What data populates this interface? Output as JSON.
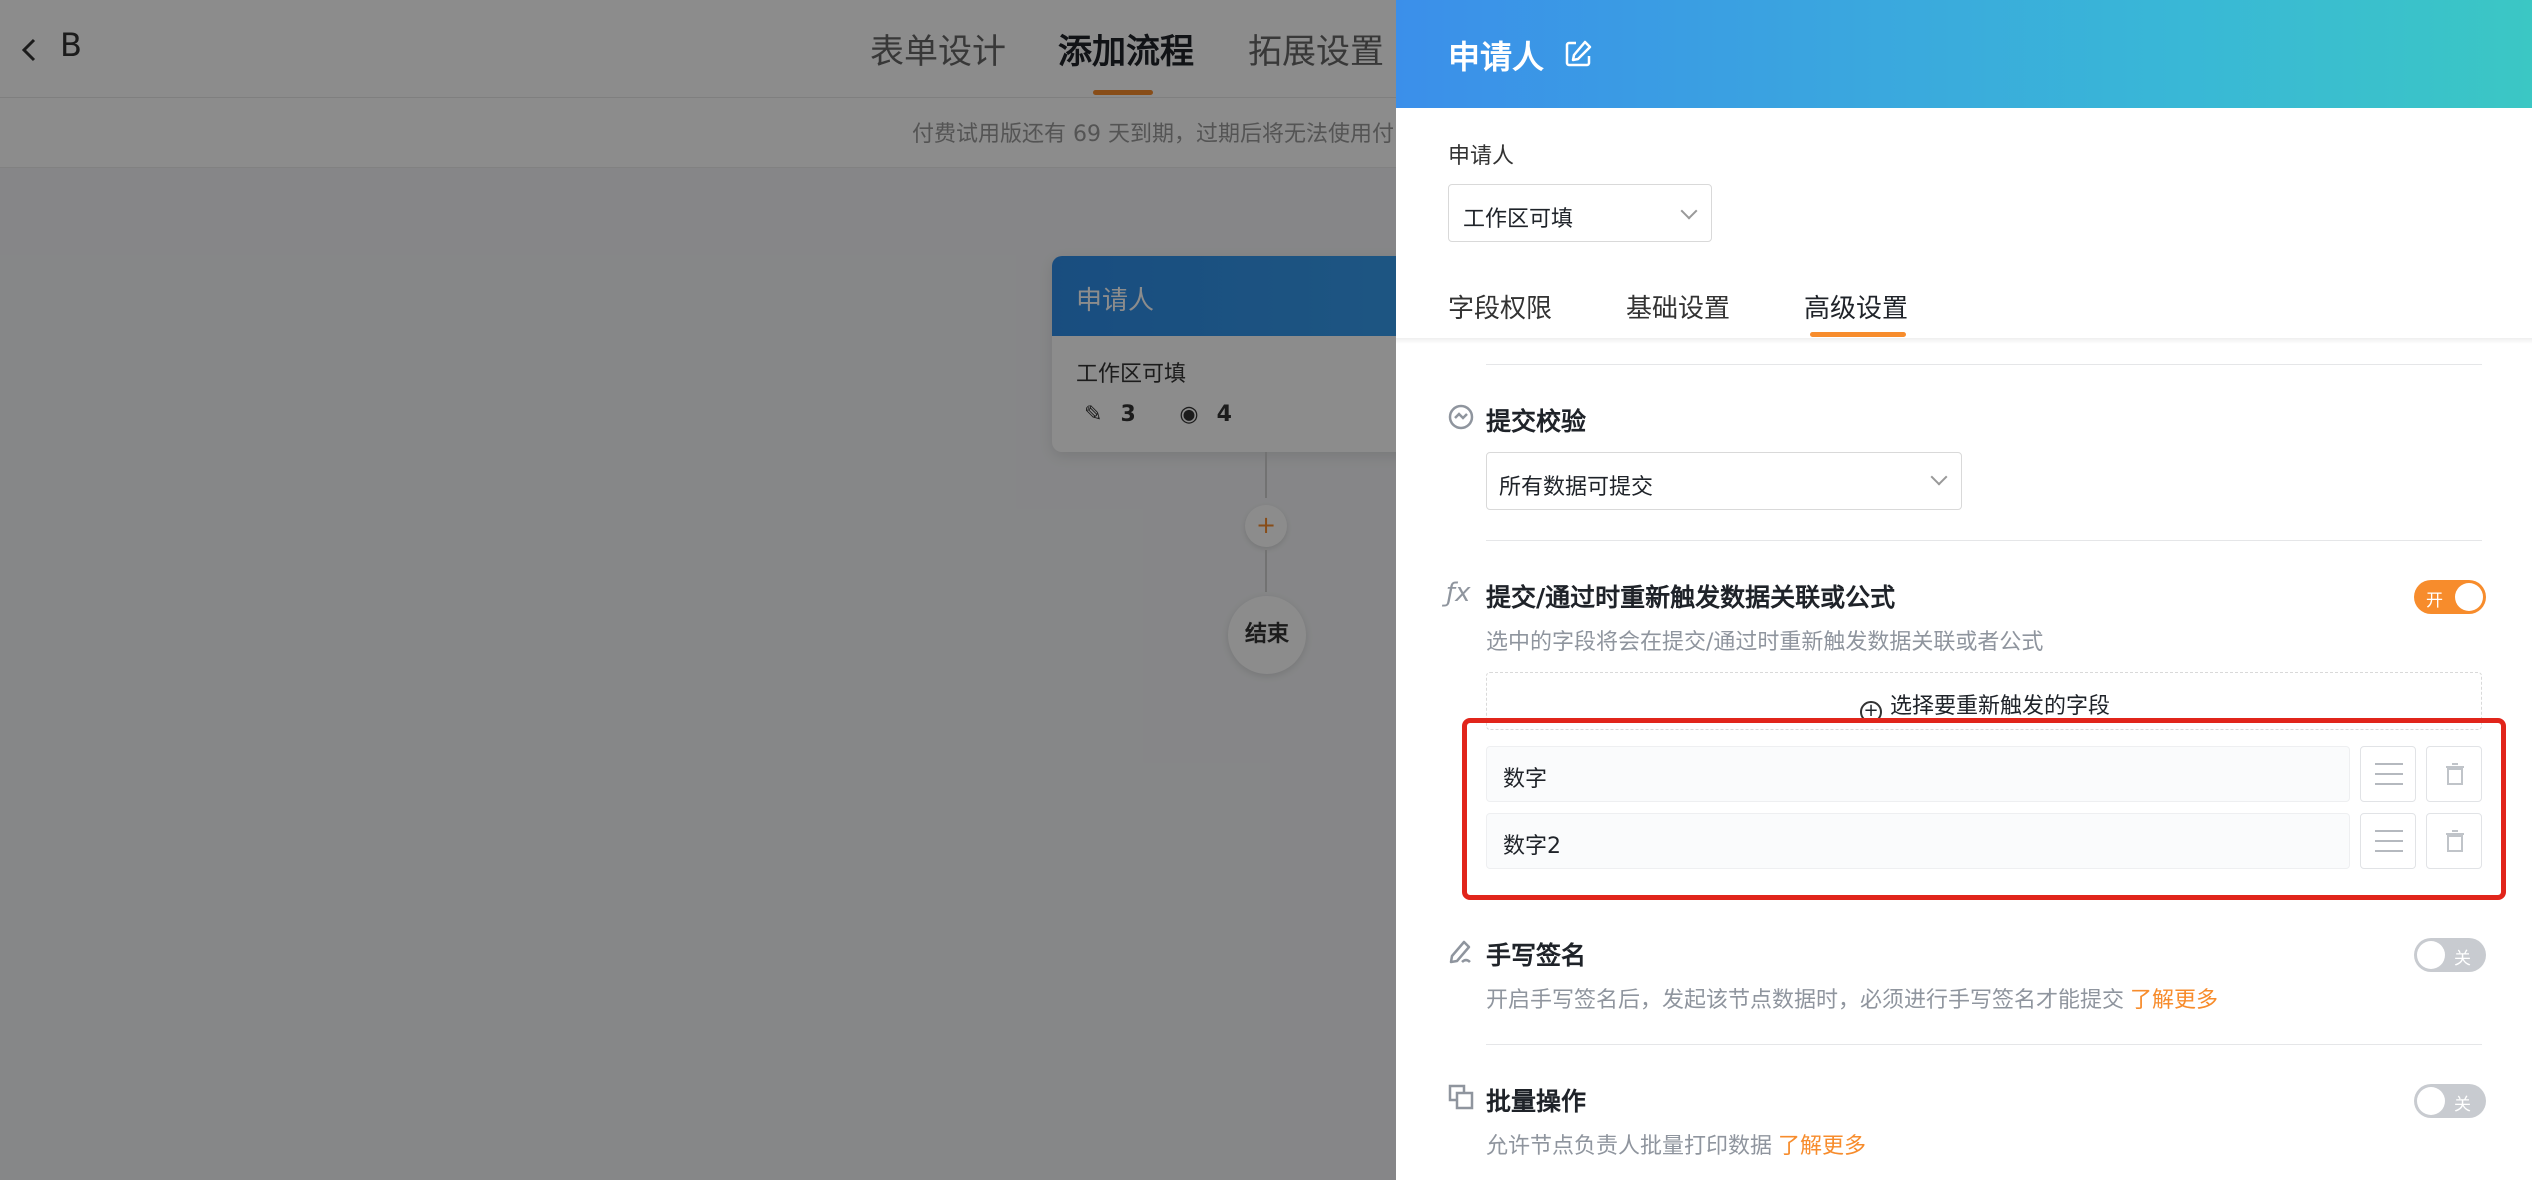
{
  "app": {
    "title": "B",
    "tabs": [
      {
        "label": "表单设计",
        "active": false
      },
      {
        "label": "添加流程",
        "active": true
      },
      {
        "label": "拓展设置",
        "active": false
      }
    ],
    "trial_notice": "付费试用版还有 69 天到期，过期后将无法使用付"
  },
  "flow": {
    "node_title": "申请人",
    "node_subtitle": "工作区可填",
    "edit_count": "3",
    "view_count": "4",
    "add_symbol": "+",
    "end_label": "结束"
  },
  "drawer": {
    "title": "申请人",
    "applicant_label": "申请人",
    "applicant_value": "工作区可填",
    "tabs": [
      {
        "label": "字段权限",
        "active": false
      },
      {
        "label": "基础设置",
        "active": false
      },
      {
        "label": "高级设置",
        "active": true
      }
    ],
    "submit_check": {
      "title": "提交校验",
      "value": "所有数据可提交"
    },
    "retrigger": {
      "title": "提交/通过时重新触发数据关联或公式",
      "description": "选中的字段将会在提交/通过时重新触发数据关联或者公式",
      "toggle_label": "开",
      "toggle_on": true,
      "select_button": "选择要重新触发的字段",
      "fields": [
        {
          "name": "数字"
        },
        {
          "name": "数字2"
        }
      ]
    },
    "signature": {
      "title": "手写签名",
      "description": "开启手写签名后，发起该节点数据时，必须进行手写签名才能提交",
      "learn_more": "了解更多",
      "toggle_label": "关",
      "toggle_on": false
    },
    "batch": {
      "title": "批量操作",
      "description": "允许节点负责人批量打印数据",
      "learn_more": "了解更多",
      "toggle_label": "关",
      "toggle_on": false
    }
  },
  "colors": {
    "accent": "#f78c2c",
    "header_start": "#3b8fea",
    "header_end": "#3bc7c4",
    "highlight_box": "#e1251b"
  }
}
